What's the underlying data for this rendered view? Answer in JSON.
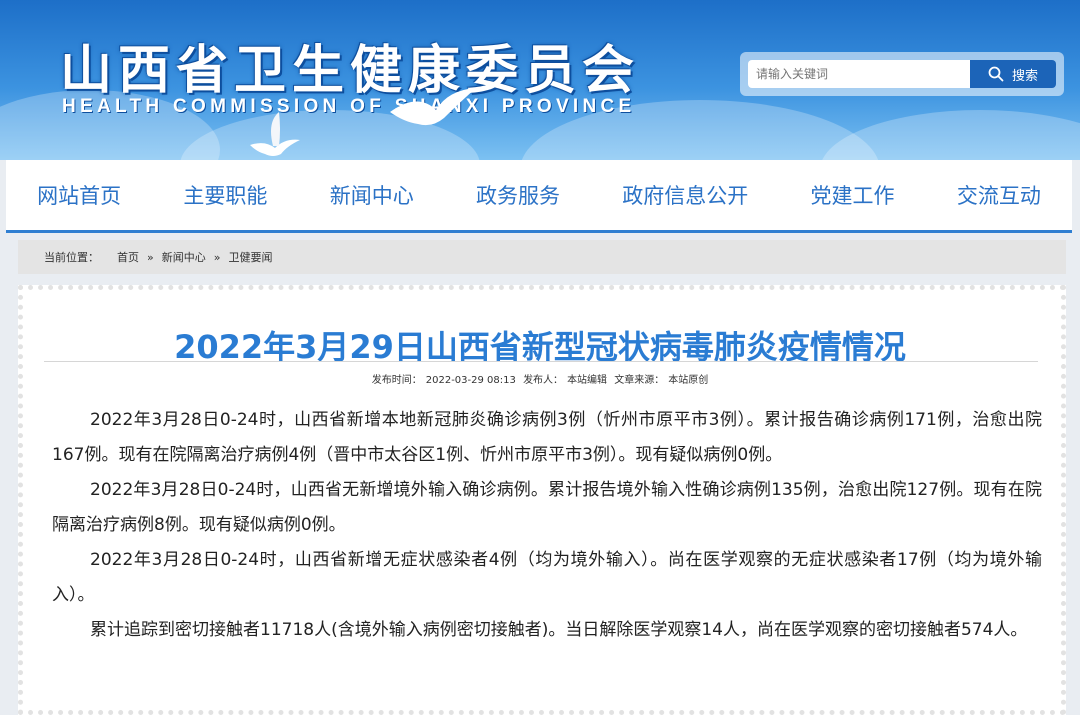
{
  "header": {
    "title_cn": "山西省卫生健康委员会",
    "title_en": "HEALTH COMMISSION OF SHANXI PROVINCE"
  },
  "search": {
    "placeholder": "请输入关键词",
    "button_label": "搜索"
  },
  "nav": {
    "items": [
      "网站首页",
      "主要职能",
      "新闻中心",
      "政务服务",
      "政府信息公开",
      "党建工作",
      "交流互动"
    ]
  },
  "breadcrumb": {
    "prefix": "当前位置：",
    "items": [
      "首页",
      "新闻中心",
      "卫健要闻"
    ],
    "separator": "»"
  },
  "article": {
    "title": "2022年3月29日山西省新型冠状病毒肺炎疫情情况",
    "meta": {
      "time_label": "发布时间：",
      "time": "2022-03-29 08:13",
      "publisher_label": "发布人：",
      "publisher": "本站编辑",
      "source_label": "文章来源：",
      "source": "本站原创"
    },
    "paragraphs": [
      "2022年3月28日0-24时，山西省新增本地新冠肺炎确诊病例3例（忻州市原平市3例）。累计报告确诊病例171例，治愈出院167例。现有在院隔离治疗病例4例（晋中市太谷区1例、忻州市原平市3例）。现有疑似病例0例。",
      "2022年3月28日0-24时，山西省无新增境外输入确诊病例。累计报告境外输入性确诊病例135例，治愈出院127例。现有在院隔离治疗病例8例。现有疑似病例0例。",
      "2022年3月28日0-24时，山西省新增无症状感染者4例（均为境外输入）。尚在医学观察的无症状感染者17例（均为境外输入）。",
      "累计追踪到密切接触者11718人(含境外输入病例密切接触者)。当日解除医学观察14人，尚在医学观察的密切接触者574人。"
    ]
  },
  "colors": {
    "brand_blue": "#2a7cd3",
    "nav_text": "#2b72c6",
    "search_button": "#1c64b8"
  }
}
